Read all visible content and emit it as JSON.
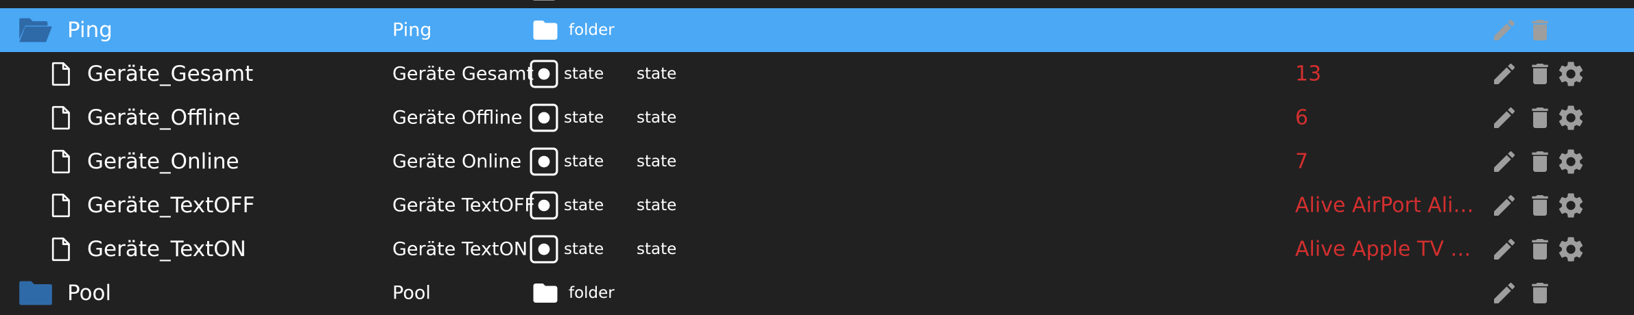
{
  "colors": {
    "background": "#212121",
    "selected_row": "#4aa8f5",
    "value_text": "#d32f2f",
    "icon_gray": "#9e9e9e",
    "folder_blue": "#2f6aa8"
  },
  "ping": {
    "name": "Ping",
    "description": "Ping",
    "type": "folder"
  },
  "states": [
    {
      "name": "Geräte_Gesamt",
      "description": "Geräte Gesamt",
      "type": "state",
      "role": "state",
      "value": "13"
    },
    {
      "name": "Geräte_Offline",
      "description": "Geräte Offline",
      "type": "state",
      "role": "state",
      "value": "6"
    },
    {
      "name": "Geräte_Online",
      "description": "Geräte Online",
      "type": "state",
      "role": "state",
      "value": "7"
    },
    {
      "name": "Geräte_TextOFF",
      "description": "Geräte TextOFF",
      "type": "state",
      "role": "state",
      "value": "Alive AirPort Alive..."
    },
    {
      "name": "Geräte_TextON",
      "description": "Geräte TextON",
      "type": "state",
      "role": "state",
      "value": "Alive Apple TV Ali..."
    }
  ],
  "pool": {
    "name": "Pool",
    "description": "Pool",
    "type": "folder"
  },
  "icons": {
    "folder_open": "folder-open-icon",
    "folder_closed": "folder-icon",
    "file": "file-icon",
    "state_type": "state-type-icon",
    "edit": "pencil-icon",
    "delete": "trash-icon",
    "settings": "gear-icon"
  }
}
